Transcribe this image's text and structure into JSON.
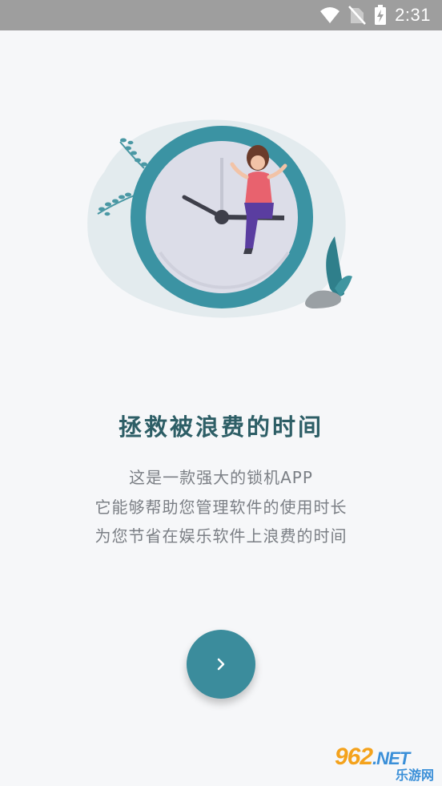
{
  "status_bar": {
    "time": "2:31",
    "icons": [
      "wifi-icon",
      "no-sim-icon",
      "battery-charging-icon"
    ]
  },
  "onboarding": {
    "title": "拯救被浪费的时间",
    "lines": [
      "这是一款强大的锁机APP",
      "它能够帮助您管理软件的使用时长",
      "为您节省在娱乐软件上浪费的时间"
    ],
    "next_icon": "chevron-right-icon"
  },
  "watermark": {
    "brand": "962",
    "suffix": ".NET",
    "subtitle": "乐游网"
  },
  "colors": {
    "accent": "#3b8c9c",
    "title": "#2d5e66",
    "text": "#7b7f85",
    "status_bar": "#9e9e9e",
    "background": "#f6f7f9"
  }
}
